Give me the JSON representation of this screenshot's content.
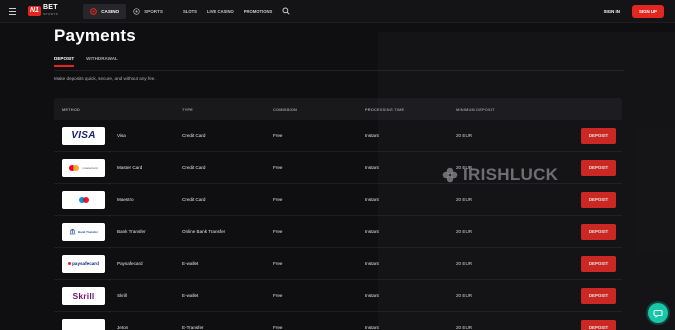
{
  "header": {
    "brand_n1": "N1",
    "brand_name": "BET",
    "brand_sub": "SPORTS",
    "tabs": [
      {
        "label": "CASINO",
        "icon": "casino-chip-icon",
        "active": true
      },
      {
        "label": "SPORTS",
        "icon": "soccer-ball-icon",
        "active": false
      }
    ],
    "links": [
      "SLOTS",
      "LIVE CASINO",
      "PROMOTIONS"
    ],
    "sign_in": "SIGN IN",
    "sign_up": "SIGN UP",
    "accent_color": "#e3261f"
  },
  "page": {
    "title": "Payments",
    "subtabs": [
      {
        "label": "DEPOSIT",
        "active": true
      },
      {
        "label": "WITHDRAWAL",
        "active": false
      }
    ],
    "description": "Make deposits quick, secure, and without any fee."
  },
  "table": {
    "columns": [
      "METHOD",
      "TYPE",
      "COMISSION",
      "PROCESSING TIME",
      "MINIMUM DEPOSIT"
    ],
    "action_label": "DEPOSIT",
    "rows": [
      {
        "method": "Visa",
        "logo": "visa",
        "logo_text": "VISA",
        "type": "Credit Card",
        "commission": "Free",
        "processing": "Instant",
        "minimum": "20 EUR"
      },
      {
        "method": "Master Card",
        "logo": "mastercard",
        "logo_text": "mastercard",
        "type": "Credit Card",
        "commission": "Free",
        "processing": "Instant",
        "minimum": "20 EUR"
      },
      {
        "method": "Maestro",
        "logo": "maestro",
        "logo_text": "",
        "type": "Credit Card",
        "commission": "Free",
        "processing": "Instant",
        "minimum": "20 EUR"
      },
      {
        "method": "Bank Transfer",
        "logo": "bank",
        "logo_text": "Bank Transfer",
        "type": "Online Bank Transfer",
        "commission": "Free",
        "processing": "Instant",
        "minimum": "20 EUR"
      },
      {
        "method": "Paysafecard",
        "logo": "paysafecard",
        "logo_text": "paysafecard",
        "type": "E-wallet",
        "commission": "Free",
        "processing": "Instant",
        "minimum": "20 EUR"
      },
      {
        "method": "Skrill",
        "logo": "skrill",
        "logo_text": "Skrill",
        "type": "E-wallet",
        "commission": "Free",
        "processing": "Instant",
        "minimum": "20 EUR"
      },
      {
        "method": "Jeton",
        "logo": "jeton",
        "logo_text": "",
        "type": "E-Transfer",
        "commission": "Free",
        "processing": "Instant",
        "minimum": "20 EUR"
      }
    ]
  },
  "watermark": "IRISHLUCK",
  "chat_icon": "chat-bubble-icon"
}
